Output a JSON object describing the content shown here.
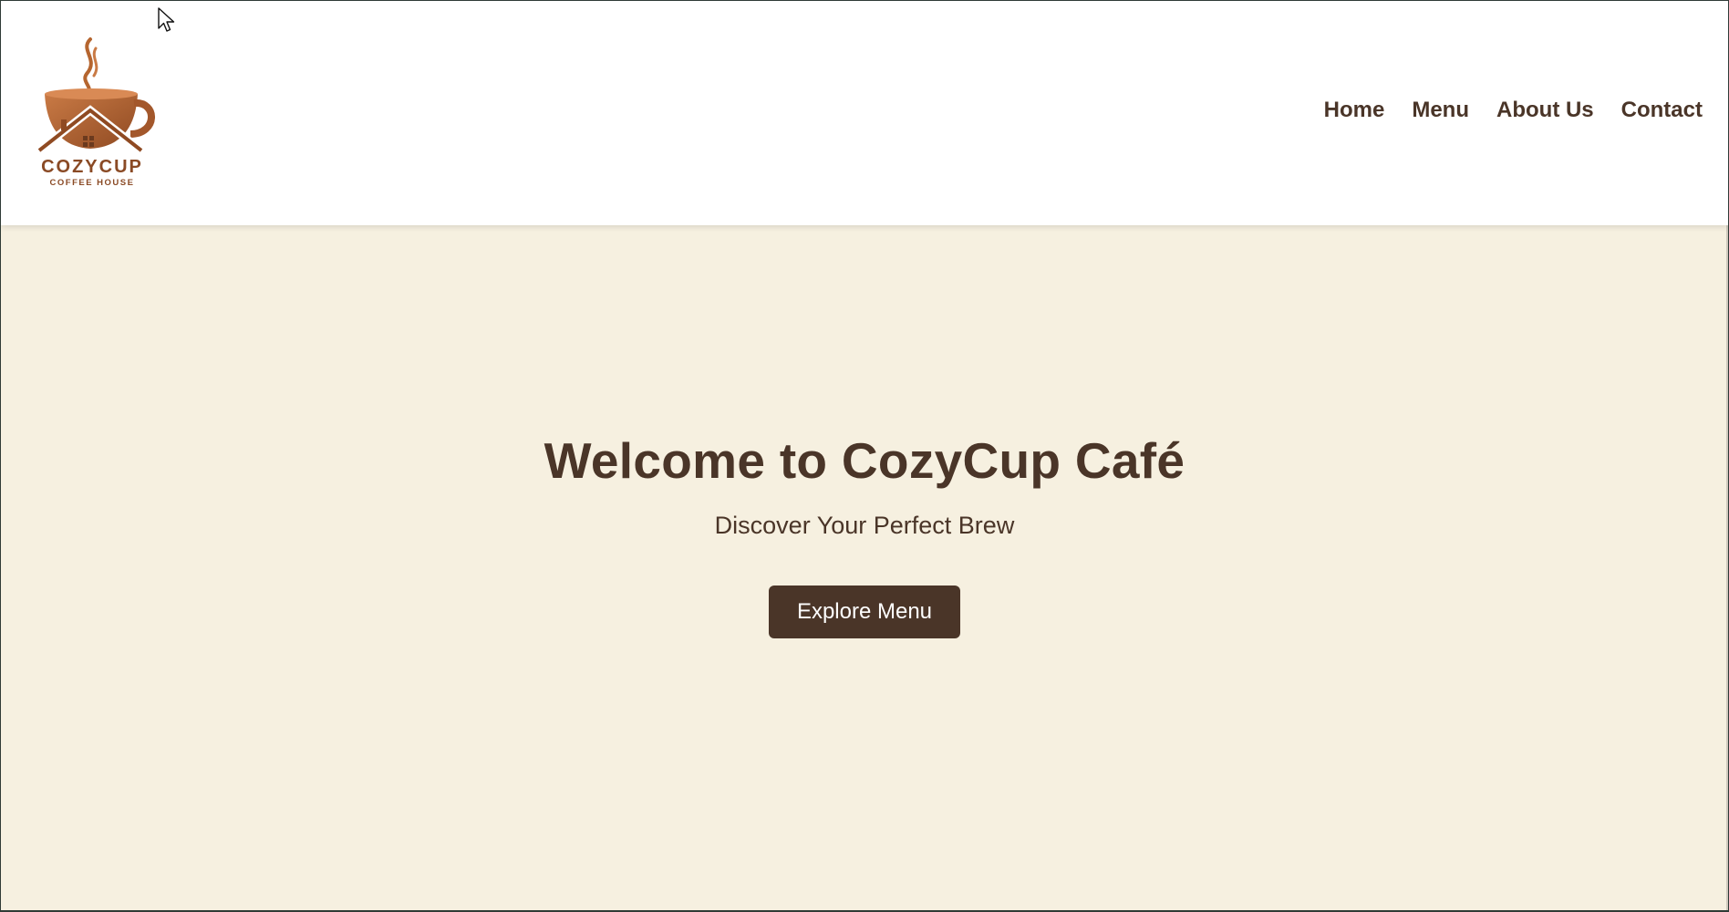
{
  "brand": {
    "name": "COZYCUP",
    "tagline": "COFFEE HOUSE",
    "logo_icon": "coffee-cup-house-logo",
    "colors": {
      "logo_primary": "#b5652f",
      "logo_text": "#8a4a25"
    }
  },
  "nav": {
    "items": [
      {
        "label": "Home"
      },
      {
        "label": "Menu"
      },
      {
        "label": "About Us"
      },
      {
        "label": "Contact"
      }
    ]
  },
  "hero": {
    "title": "Welcome to CozyCup Café",
    "subtitle": "Discover Your Perfect Brew",
    "cta_label": "Explore Menu"
  },
  "theme": {
    "header_bg": "#ffffff",
    "hero_bg": "#f6f0e0",
    "text_dark": "#4a3528",
    "button_bg": "#4a3528",
    "button_text": "#ffffff"
  }
}
